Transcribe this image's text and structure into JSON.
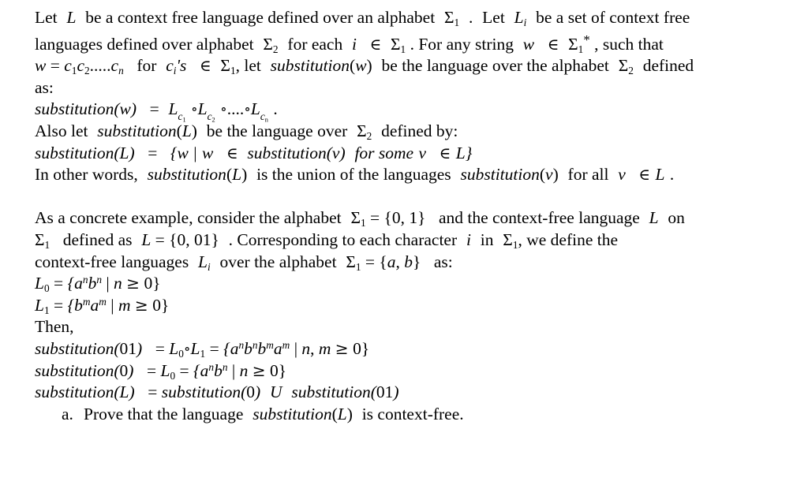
{
  "document": {
    "type": "math-text-exercise",
    "font_style": "serif",
    "text_color": "#000000",
    "background_color": "#ffffff",
    "paragraph1": {
      "segments": [
        "Let L be a context free language defined over an alphabet Σ₁ . Let Lᵢ be a set of context free languages defined over alphabet Σ₂ for each i ∈ Σ₁ . For any string w ∈ Σ₁*, such that w = c₁c₂.....cₙ for cᵢ's ∈ Σ₁ , let substitution(w) be the language over the alphabet Σ₂ defined as:"
      ],
      "line1": "Let L be a context free language defined over an alphabet Σ₁ . Let Lᵢ be a set of context free",
      "line2": "languages defined over alphabet Σ₂ for each i ∈ Σ₁ . For any string w ∈ Σ₁*, such that",
      "line3": "w = c₁c₂.....cₙ for cᵢ's ∈ Σ₁ , let substitution(w) be the language over the alphabet Σ₂ defined",
      "line4": "as:"
    },
    "equation_subst_w": "substitution(w)  = L₍ᶜ₁₎ ∘L₍ᶜ₂₎ ∘....∘L₍ᶜₙ₎ .",
    "paragraph2": {
      "line1": "Also let substitution(L) be the language over Σ₂ defined by:",
      "line2": "substitution(L)  =  {w | w ∈ substitution(v) for some v ∈ L}",
      "line3": "In other words, substitution(L) is the union of the languages substitution(v) for all v ∈ L ."
    },
    "paragraph3": {
      "line1": "As a concrete example, consider the alphabet Σ₁ = {0, 1}  and the context-free language L on",
      "line2": "Σ₁ defined as L = {0, 01} . Corresponding to each character i in Σ₁ , we define the",
      "line3": "context-free  languages Lᵢ over the alphabet Σ₁ = {a, b}  as:"
    },
    "definitions": {
      "L0": "L₀ = {aⁿbⁿ | n ≥ 0}",
      "L1": "L₁ = {bᵐaᵐ | m ≥ 0}",
      "then_label": "Then,"
    },
    "results": {
      "subst_01": "substitution(01)  = L₀∘L₁ = {aⁿbⁿbᵐaᵐ | n, m ≥ 0}",
      "subst_0": "substitution(0)  = L₀ = {aⁿbⁿ | n ≥ 0}",
      "subst_L": "substitution(L)  = substitution(0) U substitution(01)"
    },
    "question": {
      "marker": "a.",
      "text": "Prove that the language substitution(L) is context-free."
    },
    "tokens": {
      "let": "Let",
      "be_a_cfl": "be a context free language defined over an alphabet",
      "dot": ".",
      "let2": "Let",
      "be_set_of": "be a set of context free",
      "languages_defined_over": "languages defined over alphabet",
      "for_each": "for each",
      "for_any_string": ". For any string",
      "such_that": ", such that",
      "for": "for",
      "let3": ", let",
      "substitution": "substitution",
      "be_the_language_over": "be the language over the alphabet",
      "defined": "defined",
      "as_colon": "as:",
      "also_let": "Also let",
      "be_lang_over": "be the language over",
      "defined_by": "defined by:",
      "for_some": "for some",
      "in_other_words": "In other words,",
      "is_union": "is the union of the languages",
      "for_all": "for all",
      "as_concrete": "As a concrete example, consider the alphabet",
      "and_the_cfl": "and the context-free language",
      "on": "on",
      "defined_as": "defined as",
      "corresponding": ". Corresponding to each character",
      "in": "in",
      "we_define_the": ", we define the",
      "context_free_languages": "context-free  languages",
      "over_alphabet": "over the alphabet",
      "as2": "as:",
      "then": "Then,",
      "prove_that_the_language": "Prove that the language",
      "is_context_free": "is context-free.",
      "union_op": "U",
      "sigma": "Σ",
      "elem_of": "∈",
      "ring_op": "∘",
      "geq": "≥",
      "star": "*"
    }
  }
}
